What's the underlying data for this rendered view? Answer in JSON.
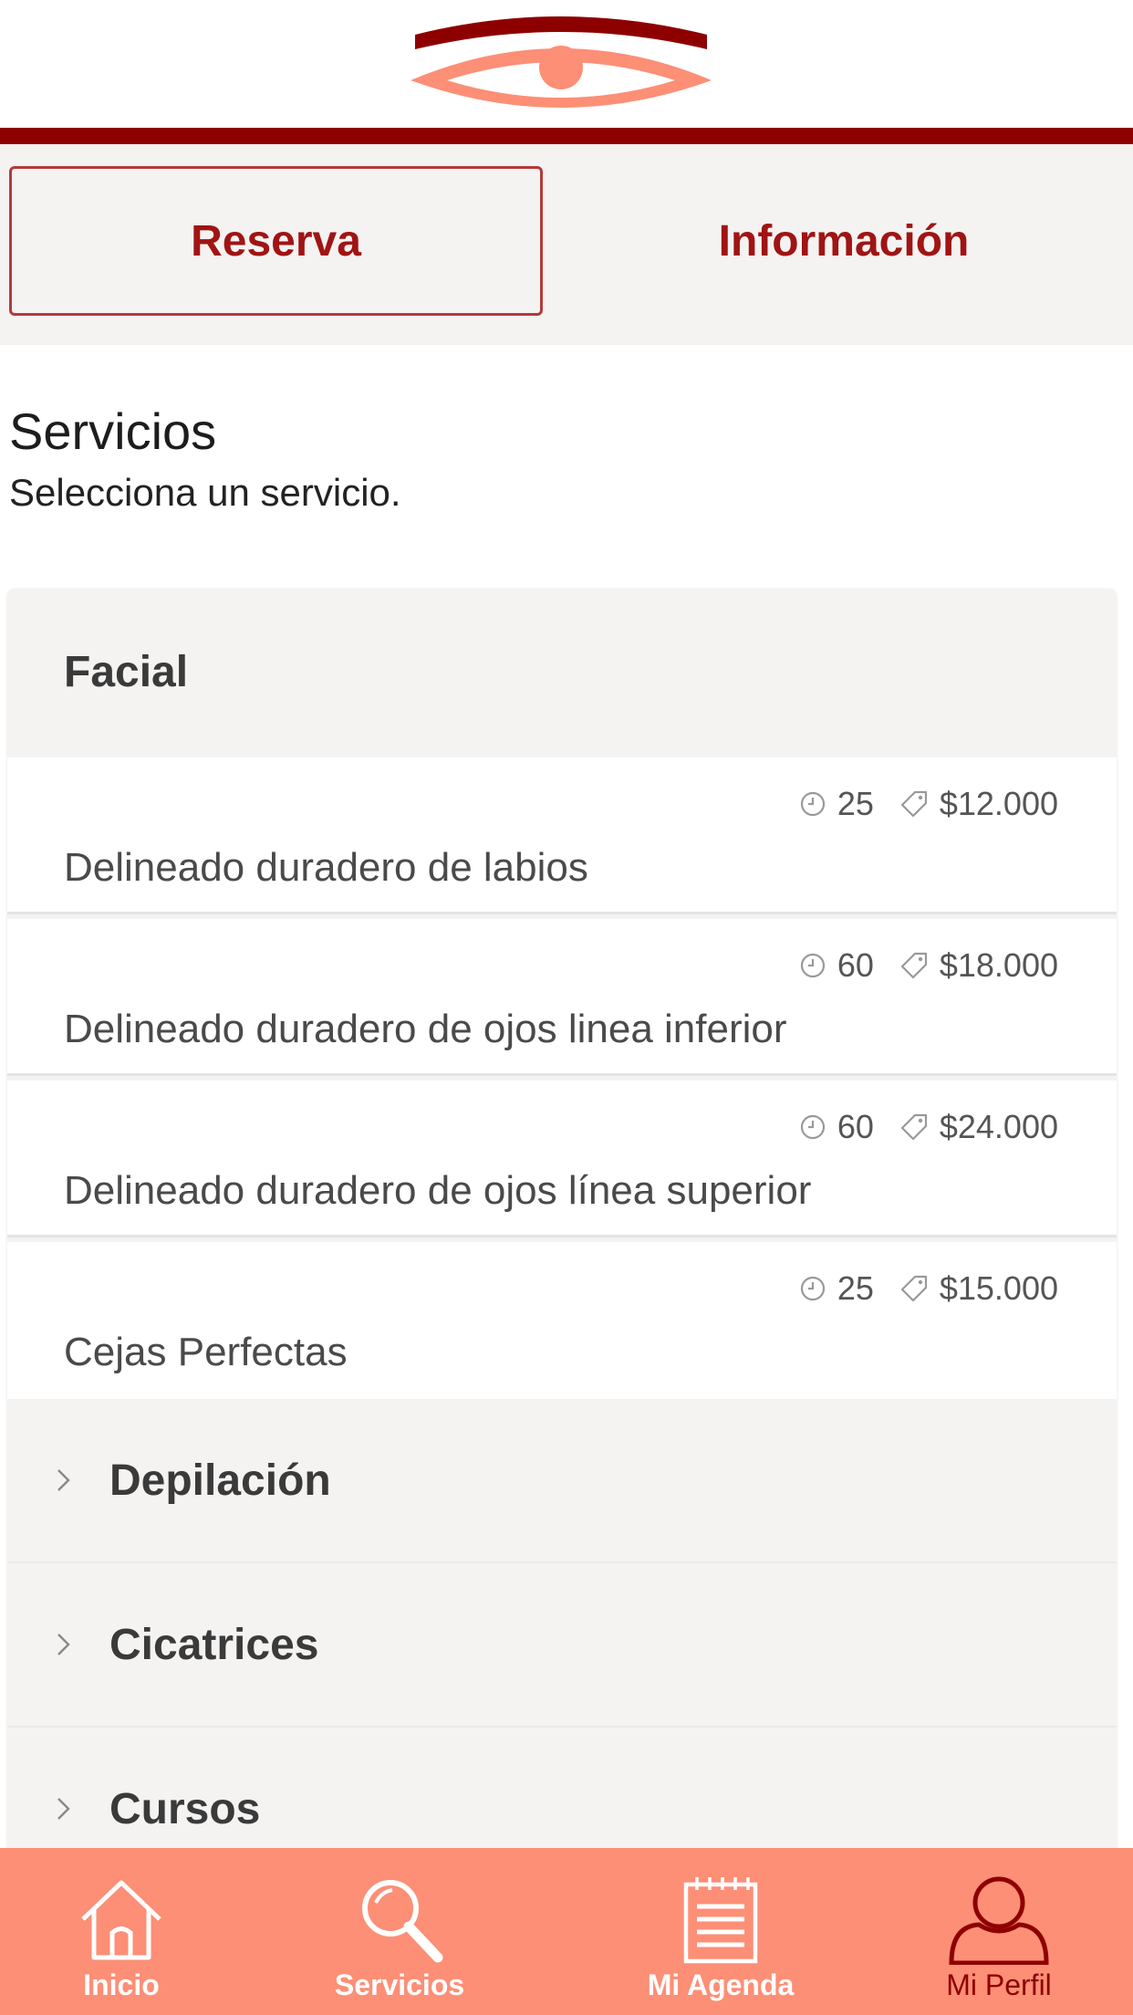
{
  "colors": {
    "brand_dark": "#8e0000",
    "accent": "#a01414",
    "nav_bg": "#fc8f76",
    "panel_bg": "#f4f3f1"
  },
  "tabs": [
    {
      "label": "Reserva",
      "selected": true
    },
    {
      "label": "Información",
      "selected": false
    }
  ],
  "section": {
    "title": "Servicios",
    "subtitle": "Selecciona un servicio."
  },
  "categories": {
    "open": {
      "name": "Facial"
    },
    "services": [
      {
        "duration": "25",
        "price": "$12.000",
        "name": "Delineado duradero de labios"
      },
      {
        "duration": "60",
        "price": "$18.000",
        "name": "Delineado duradero de ojos linea inferior"
      },
      {
        "duration": "60",
        "price": "$24.000",
        "name": "Delineado duradero de ojos línea superior"
      },
      {
        "duration": "25",
        "price": "$15.000",
        "name": "Cejas Perfectas"
      }
    ],
    "collapsed": [
      {
        "name": "Depilación"
      },
      {
        "name": "Cicatrices"
      },
      {
        "name": "Cursos"
      }
    ]
  },
  "bottom_nav": [
    {
      "label": "Inicio",
      "icon": "home-icon"
    },
    {
      "label": "Servicios",
      "icon": "search-icon"
    },
    {
      "label": "Mi Agenda",
      "icon": "agenda-icon"
    },
    {
      "label": "Mi Perfil",
      "icon": "profile-icon",
      "active": true
    }
  ]
}
